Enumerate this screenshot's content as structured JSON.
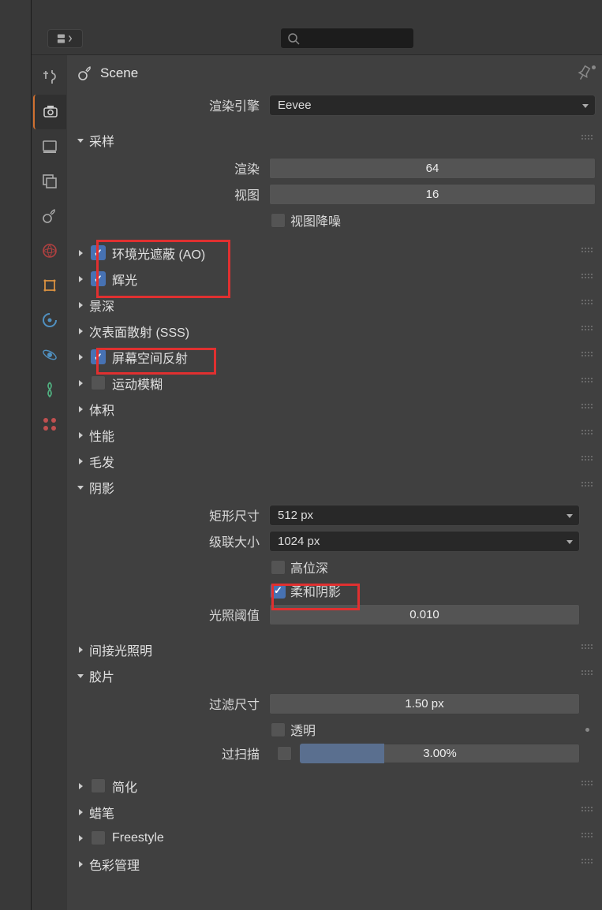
{
  "breadcrumb": {
    "scene": "Scene"
  },
  "engine": {
    "label": "渲染引擎",
    "value": "Eevee"
  },
  "sampling": {
    "title": "采样",
    "render_label": "渲染",
    "render_value": "64",
    "viewport_label": "视图",
    "viewport_value": "16",
    "denoise_label": "视图降噪"
  },
  "panels": {
    "ao": "环境光遮蔽 (AO)",
    "bloom": "辉光",
    "dof": "景深",
    "sss": "次表面散射 (SSS)",
    "ssr": "屏幕空间反射",
    "motion_blur": "运动模糊",
    "volumetrics": "体积",
    "performance": "性能",
    "hair": "毛发",
    "shadows": "阴影",
    "indirect": "间接光照明",
    "film": "胶片",
    "simplify": "简化",
    "gpencil": "蜡笔",
    "freestyle": "Freestyle",
    "color_mgmt": "色彩管理"
  },
  "shadows": {
    "cube_label": "矩形尺寸",
    "cube_value": "512 px",
    "cascade_label": "级联大小",
    "cascade_value": "1024 px",
    "high_bit_label": "高位深",
    "soft_label": "柔和阴影",
    "threshold_label": "光照阈值",
    "threshold_value": "0.010"
  },
  "film": {
    "filter_label": "过滤尺寸",
    "filter_value": "1.50 px",
    "transparent_label": "透明",
    "overscan_label": "过扫描",
    "overscan_value": "3.00%"
  },
  "ao_checked": true,
  "bloom_checked": true,
  "ssr_checked": true,
  "soft_shadow_checked": true
}
